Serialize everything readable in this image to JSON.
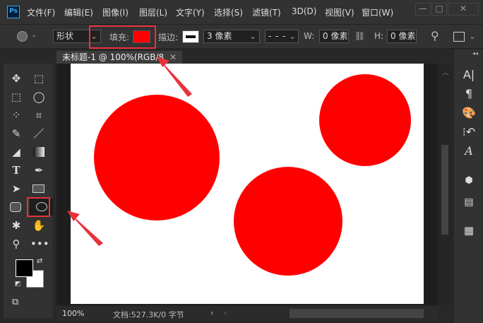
{
  "menubar": {
    "logo": "Ps",
    "items": [
      "文件(F)",
      "编辑(E)",
      "图像(I)",
      "图层(L)",
      "文字(Y)",
      "选择(S)",
      "滤镜(T)",
      "3D(D)",
      "视图(V)",
      "窗口(W)"
    ],
    "window_controls": [
      "minimize",
      "maximize",
      "close"
    ]
  },
  "options": {
    "tool_icon": "ellipse-icon",
    "mode": "形状",
    "fill_label": "填充:",
    "fill_color": "#ff0000",
    "stroke_label": "描边:",
    "stroke_width": "3 像素",
    "w_label": "W:",
    "w_value": "0 像素",
    "h_label": "H:",
    "h_value": "0 像素"
  },
  "document": {
    "tab_title": "未标题-1 @ 100%(RGB/8",
    "zoom": "100%",
    "doc_info": "文档:527.3K/0 字节",
    "shape_color": "#ff0000"
  },
  "toolbar": {
    "tools": [
      "move",
      "artboard",
      "marquee",
      "lasso",
      "quick-selection",
      "crop",
      "eyedropper",
      "brush",
      "eraser",
      "gradient",
      "type",
      "pen",
      "path-selection",
      "rectangle",
      "rounded-rectangle",
      "ellipse",
      "custom-shape",
      "hand",
      "zoom",
      "more"
    ],
    "selected": "ellipse",
    "foreground": "#000000",
    "background": "#ffffff"
  },
  "right_panel": {
    "icons": [
      "character",
      "paragraph",
      "swatches",
      "history",
      "glyphs",
      "3d",
      "properties",
      "grid"
    ]
  }
}
